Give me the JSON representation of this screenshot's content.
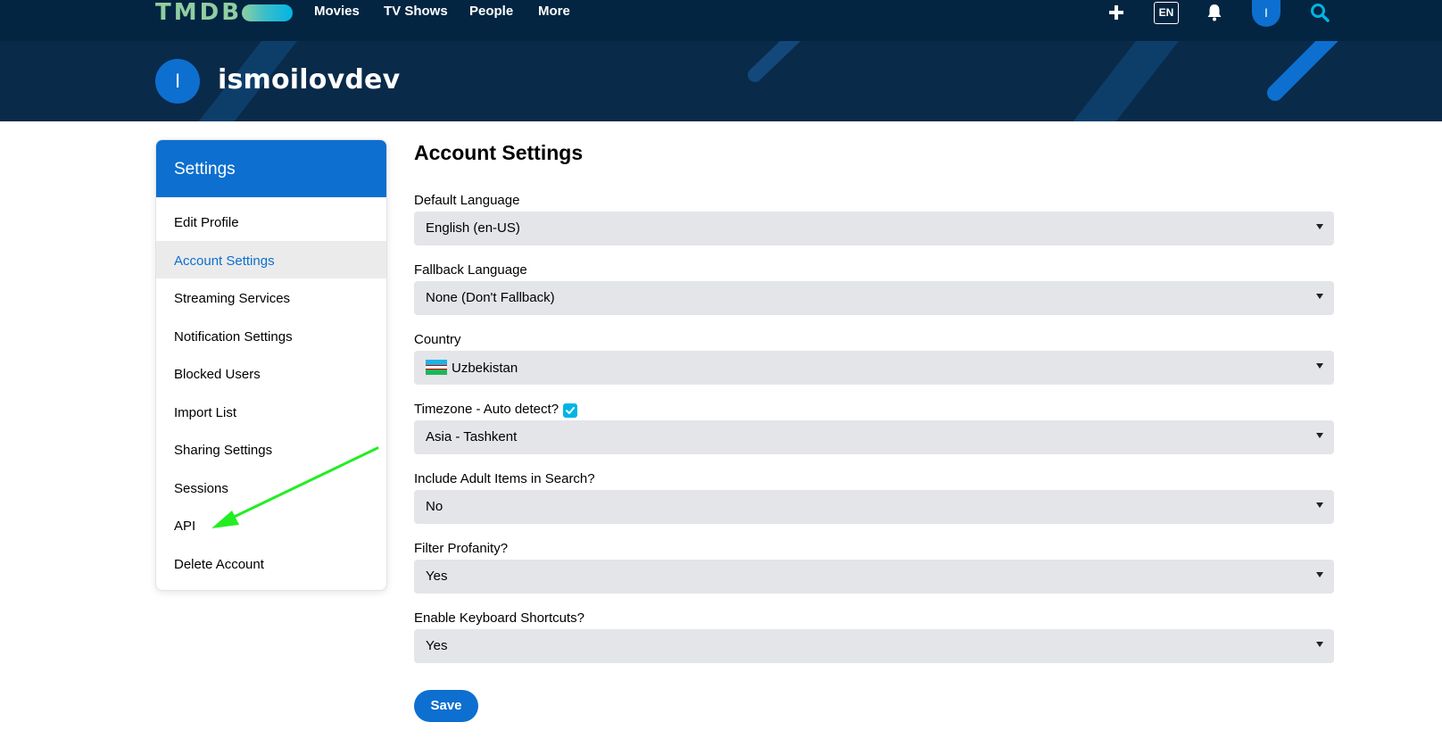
{
  "nav": {
    "logo": "TMDB",
    "links": [
      "Movies",
      "TV Shows",
      "People",
      "More"
    ],
    "language": "EN",
    "avatar_initial": "I",
    "icons": [
      "add-icon",
      "bell-icon",
      "search-icon"
    ]
  },
  "profile": {
    "initial": "I",
    "username": "ismoilovdev"
  },
  "sidebar": {
    "title": "Settings",
    "items": [
      {
        "label": "Edit Profile"
      },
      {
        "label": "Account Settings",
        "active": true
      },
      {
        "label": "Streaming Services"
      },
      {
        "label": "Notification Settings"
      },
      {
        "label": "Blocked Users"
      },
      {
        "label": "Import List"
      },
      {
        "label": "Sharing Settings"
      },
      {
        "label": "Sessions"
      },
      {
        "label": "API"
      },
      {
        "label": "Delete Account"
      }
    ]
  },
  "main": {
    "title": "Account Settings",
    "fields": [
      {
        "label": "Default Language",
        "value": "English (en-US)"
      },
      {
        "label": "Fallback Language",
        "value": "None (Don't Fallback)"
      },
      {
        "label": "Country",
        "value": "Uzbekistan",
        "flag": "uzbekistan-flag-icon"
      },
      {
        "label": "Timezone - Auto detect?",
        "value": "Asia - Tashkent",
        "checked": true
      },
      {
        "label": "Include Adult Items in Search?",
        "value": "No"
      },
      {
        "label": "Filter Profanity?",
        "value": "Yes"
      },
      {
        "label": "Enable Keyboard Shortcuts?",
        "value": "Yes"
      }
    ],
    "save_label": "Save"
  },
  "colors": {
    "nav_bg": "#032541",
    "accent_blue": "#0d6fcf",
    "logo_green": "#90cea1",
    "light_blue": "#01b4e4",
    "select_bg": "#e3e5e9",
    "annotation_arrow": "#22ee22"
  }
}
